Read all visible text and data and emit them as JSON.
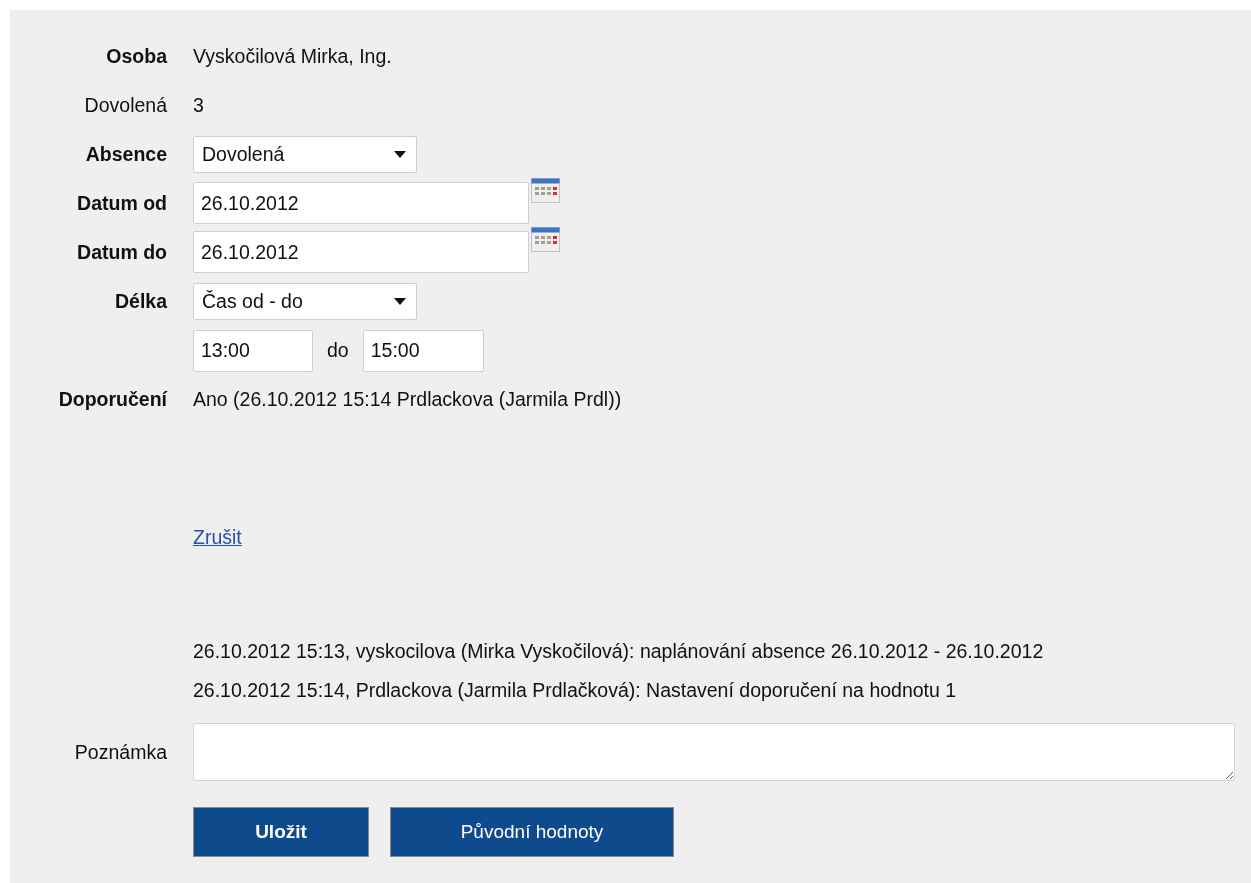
{
  "rows": [
    {
      "kind": "text",
      "label": "Osoba",
      "bold": true,
      "value": "Vyskočilová Mirka, Ing."
    },
    {
      "kind": "text",
      "label": "Dovolená",
      "bold": false,
      "value": "3"
    },
    {
      "kind": "select",
      "label": "Absence",
      "bold": true,
      "value": "Dovolená"
    },
    {
      "kind": "date",
      "label": "Datum od",
      "bold": true,
      "value": "26.10.2012"
    },
    {
      "kind": "date",
      "label": "Datum do",
      "bold": true,
      "value": "26.10.2012"
    },
    {
      "kind": "select",
      "label": "Délka",
      "bold": true,
      "value": "Čas od - do"
    },
    {
      "kind": "time-range",
      "from": "13:00",
      "separator": "do",
      "to": "15:00"
    },
    {
      "kind": "text",
      "label": "Doporučení",
      "bold": true,
      "value": "Ano (26.10.2012 15:14 Prdlackova (Jarmila Prdl))"
    }
  ],
  "cancel_link": "Zrušit",
  "history": [
    "26.10.2012 15:13, vyskocilova (Mirka Vyskočilová): naplánování absence 26.10.2012 - 26.10.2012",
    "26.10.2012 15:14, Prdlackova (Jarmila Prdlačková): Nastavení doporučení na hodnotu 1"
  ],
  "note": {
    "label": "Poznámka",
    "bold": false
  },
  "buttons": [
    {
      "label": "Uložit",
      "bold": true
    },
    {
      "label": "Původní hodnoty",
      "bold": false
    }
  ]
}
